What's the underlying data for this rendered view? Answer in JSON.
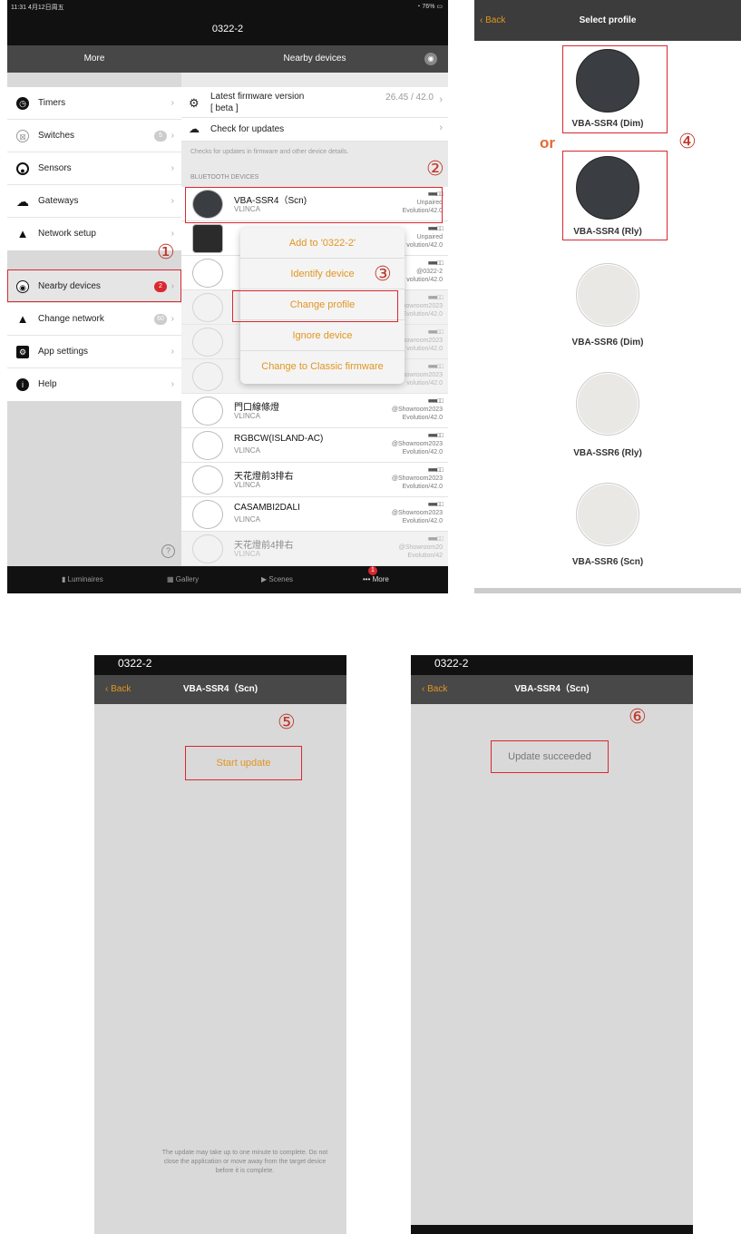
{
  "panel1": {
    "status": {
      "time": "11:31",
      "date": "4月12日周五",
      "battery": "76%"
    },
    "title": "0322-2",
    "nav_left": "More",
    "nav_right": "Nearby devices",
    "menu": [
      {
        "label": "Timers",
        "icon": "clock-icon"
      },
      {
        "label": "Switches",
        "icon": "switches-icon",
        "badge": "5"
      },
      {
        "label": "Sensors",
        "icon": "sensor-icon"
      },
      {
        "label": "Gateways",
        "icon": "gateway-icon"
      },
      {
        "label": "Network setup",
        "icon": "network-icon"
      },
      {
        "label": "Nearby devices",
        "icon": "nearby-icon",
        "badge": "2"
      },
      {
        "label": "Change network",
        "icon": "network-icon",
        "badge": "60"
      },
      {
        "label": "App settings",
        "icon": "settings-icon"
      },
      {
        "label": "Help",
        "icon": "info-icon"
      }
    ],
    "firmware": {
      "label": "Latest firmware version",
      "sub": "[ beta ]",
      "value": "26.45 / 42.0"
    },
    "check_updates": "Check for updates",
    "check_note": "Checks for updates in firmware and other device details.",
    "section": "BLUETOOTH DEVICES",
    "devices": [
      {
        "name": "VBA-SSR4（Scn)",
        "sub": "VLINCA",
        "status1": "Unpaired",
        "status2": "Evolution/42.0"
      },
      {
        "name": "",
        "sub": "",
        "status1": "Unpaired",
        "status2": "volution/42.0"
      },
      {
        "name": "",
        "sub": "",
        "status1": "@0322-2",
        "status2": "volution/42.0"
      },
      {
        "name": "",
        "sub": "",
        "status1": "@Showroom2023",
        "status2": "Evolution/42.0"
      },
      {
        "name": "",
        "sub": "",
        "status1": "howroom2023",
        "status2": "volution/42.0"
      },
      {
        "name": "",
        "sub": "",
        "status1": "howroom2023",
        "status2": "volution/42.0"
      },
      {
        "name": "門口線條燈",
        "sub": "VLINCA",
        "status1": "@Showroom2023",
        "status2": "Evolution/42.0"
      },
      {
        "name": "RGBCW(ISLAND-AC)",
        "sub": "VLINCA",
        "status1": "@Showroom2023",
        "status2": "Evolution/42.0"
      },
      {
        "name": "天花燈前3排右",
        "sub": "VLINCA",
        "status1": "@Showroom2023",
        "status2": "Evolution/42.0"
      },
      {
        "name": "CASAMBI2DALI",
        "sub": "VLINCA",
        "status1": "@Showroom2023",
        "status2": "Evolution/42.0"
      },
      {
        "name": "天花燈前4排右",
        "sub": "VLINCA",
        "status1": "@Showroom20",
        "status2": "Evolution/42"
      }
    ],
    "popup": [
      "Add to '0322-2'",
      "Identify device",
      "Change profile",
      "Ignore device",
      "Change to Classic firmware"
    ],
    "tabs": [
      "Luminaires",
      "Gallery",
      "Scenes",
      "More"
    ],
    "more_badge": "1",
    "steps": [
      "①",
      "②",
      "③"
    ]
  },
  "panel2": {
    "back": "Back",
    "title": "Select profile",
    "or": "or",
    "step": "④",
    "profiles": [
      "VBA-SSR4 (Dim)",
      "VBA-SSR4 (Rly)",
      "VBA-SSR6 (Dim)",
      "VBA-SSR6 (Rly)",
      "VBA-SSR6 (Scn)"
    ]
  },
  "panel3": {
    "network": "0322-2",
    "back": "Back",
    "title": "VBA-SSR4（Scn)",
    "step": "⑤",
    "button": "Start update",
    "note": "The update may take up to one minute to complete. Do not close the application or move away from the target device before it is complete."
  },
  "panel4": {
    "network": "0322-2",
    "back": "Back",
    "title": "VBA-SSR4（Scn)",
    "step": "⑥",
    "status": "Update succeeded"
  },
  "colors": {
    "accent": "#e29521",
    "highlight": "#d9282f"
  }
}
